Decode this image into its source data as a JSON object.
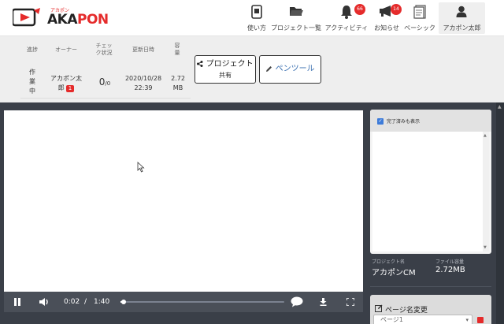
{
  "logo": {
    "small": "アカポン",
    "text_main": "AKA",
    "text_accent": "PON",
    "brand_color": "#e52b2b"
  },
  "nav": {
    "items": [
      {
        "label": "使い方",
        "icon": "tablet-help-icon"
      },
      {
        "label": "プロジェクト一覧",
        "icon": "folder-open-icon"
      },
      {
        "label": "アクティビティ",
        "icon": "bell-icon",
        "badge": "66"
      },
      {
        "label": "お知らせ",
        "icon": "megaphone-icon",
        "badge": "14"
      },
      {
        "label": "ベーシック",
        "icon": "plan-document-icon"
      },
      {
        "label": "アカポン太郎",
        "icon": "user-icon"
      }
    ]
  },
  "info": {
    "headers": {
      "progress": "進捗",
      "owner": "オーナー",
      "check_l1": "チェッ",
      "check_l2": "ク状況",
      "updated": "更新日時",
      "size_l1": "容",
      "size_l2": "量"
    },
    "values": {
      "progress_l1": "作",
      "progress_l2": "業",
      "progress_l3": "中",
      "owner_l1": "アカポン太",
      "owner_l2": "郎",
      "owner_badge": "1",
      "check_main": "0",
      "check_sub": "/0",
      "updated_date": "2020/10/28",
      "updated_time": "22:39",
      "size_val": "2.72",
      "size_unit": "MB"
    },
    "share_button_l1": "プロジェクト",
    "share_button_l2": "共有",
    "pen_tool_label": "ペンツール"
  },
  "player": {
    "current_time": "0:02",
    "divider": "/",
    "total_time": "1:40",
    "progress": 0.02
  },
  "side": {
    "show_completed": "完了済みも表示",
    "project_name_label": "プロジェクト名",
    "project_name": "アカポンCM",
    "file_size_label": "ファイル容量",
    "file_size": "2.72MB",
    "page_rename_label": "ページ名変更",
    "page_select_value": "ページ1"
  }
}
